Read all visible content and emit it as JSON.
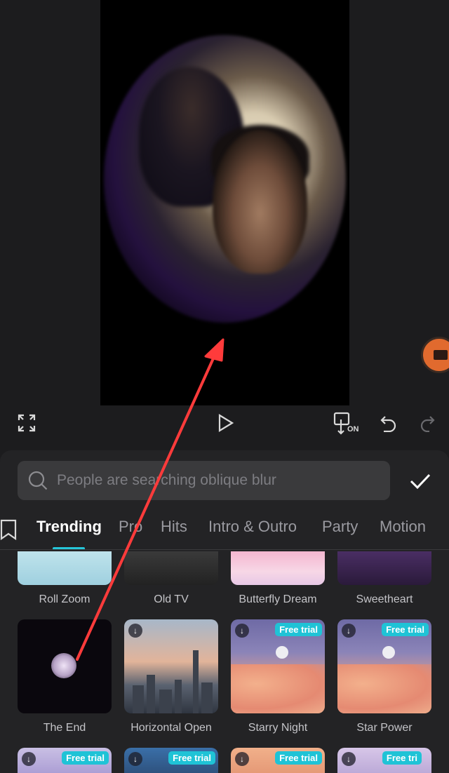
{
  "search": {
    "placeholder": "People are searching oblique blur"
  },
  "tabs": [
    {
      "label": "Trending",
      "active": true
    },
    {
      "label": "Pro",
      "active": false
    },
    {
      "label": "Hits",
      "active": false
    },
    {
      "label": "Intro & Outro",
      "active": false
    },
    {
      "label": "Party",
      "active": false
    },
    {
      "label": "Motion",
      "active": false
    }
  ],
  "effects": [
    {
      "label": "Roll Zoom",
      "badge": "",
      "download": false
    },
    {
      "label": "Old TV",
      "badge": "",
      "download": false
    },
    {
      "label": "Butterfly Dream",
      "badge": "",
      "download": false
    },
    {
      "label": "Sweetheart",
      "badge": "",
      "download": false
    },
    {
      "label": "The End",
      "badge": "",
      "download": false
    },
    {
      "label": "Horizontal Open",
      "badge": "",
      "download": true
    },
    {
      "label": "Starry Night",
      "badge": "Free trial",
      "download": true
    },
    {
      "label": "Star Power",
      "badge": "Free trial",
      "download": true
    },
    {
      "label": "",
      "badge": "Free trial",
      "download": true
    },
    {
      "label": "",
      "badge": "Free trial",
      "download": true
    },
    {
      "label": "",
      "badge": "Free trial",
      "download": true
    },
    {
      "label": "",
      "badge": "Free tri",
      "download": true
    }
  ],
  "toolbar": {
    "fullscreen_icon": "fullscreen-icon",
    "play_icon": "play-icon",
    "keyframe_icon": "keyframe-on-icon",
    "keyframe_text": "ON",
    "undo_icon": "undo-icon",
    "redo_icon": "redo-icon"
  },
  "colors": {
    "accent": "#1fc3d6",
    "record_button": "#e16a2e",
    "annotation_arrow": "#ff3b3b"
  }
}
